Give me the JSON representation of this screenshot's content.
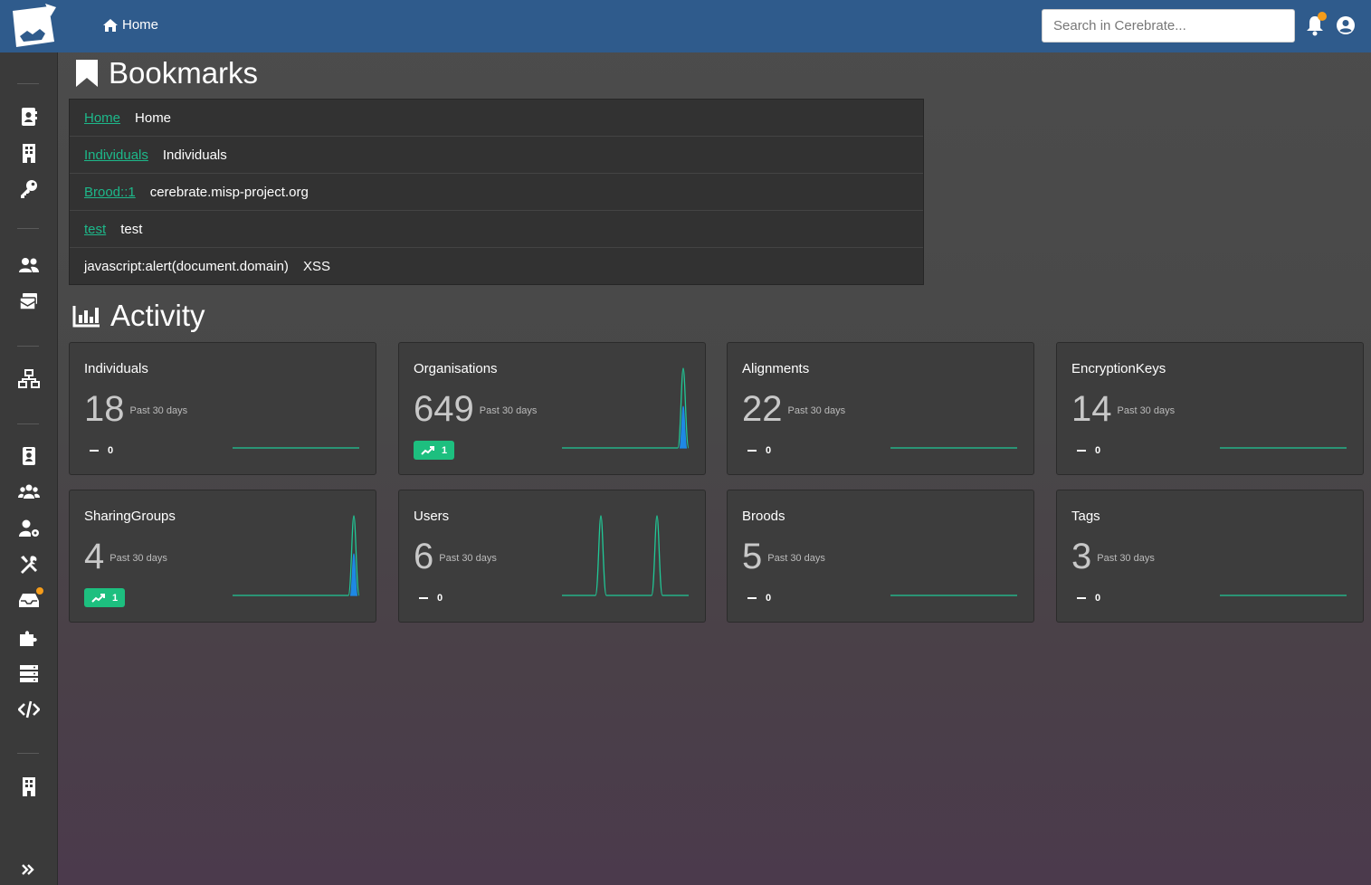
{
  "header": {
    "home_label": "Home",
    "search_placeholder": "Search in Cerebrate...",
    "has_notification": true
  },
  "bookmarks": {
    "title": "Bookmarks",
    "rows": [
      {
        "link": "Home",
        "name": "Home",
        "linked": true
      },
      {
        "link": "Individuals",
        "name": "Individuals",
        "linked": true
      },
      {
        "link": "Brood::1",
        "name": "cerebrate.misp-project.org",
        "linked": true
      },
      {
        "link": "test",
        "name": "test",
        "linked": true
      },
      {
        "link": "javascript:alert(document.domain)",
        "name": "XSS",
        "linked": false
      }
    ]
  },
  "activity": {
    "title": "Activity",
    "range_label": "Past 30 days",
    "cards": [
      {
        "title": "Individuals",
        "count": "18",
        "trend": "0",
        "trend_up": false,
        "spark": "flat"
      },
      {
        "title": "Organisations",
        "count": "649",
        "trend": "1",
        "trend_up": true,
        "spark": "end-spike"
      },
      {
        "title": "Alignments",
        "count": "22",
        "trend": "0",
        "trend_up": false,
        "spark": "flat"
      },
      {
        "title": "EncryptionKeys",
        "count": "14",
        "trend": "0",
        "trend_up": false,
        "spark": "flat"
      },
      {
        "title": "SharingGroups",
        "count": "4",
        "trend": "1",
        "trend_up": true,
        "spark": "end-spike"
      },
      {
        "title": "Users",
        "count": "6",
        "trend": "0",
        "trend_up": false,
        "spark": "double-spike"
      },
      {
        "title": "Broods",
        "count": "5",
        "trend": "0",
        "trend_up": false,
        "spark": "flat"
      },
      {
        "title": "Tags",
        "count": "3",
        "trend": "0",
        "trend_up": false,
        "spark": "flat"
      }
    ]
  },
  "sidebar": {
    "items": [
      "contacts-icon",
      "building-icon",
      "key-icon",
      "users-icon",
      "inbox-icon",
      "network-icon",
      "id-card-icon",
      "group-icon",
      "user-cog-icon",
      "tools-icon",
      "inbox-notification-icon",
      "puzzle-icon",
      "server-icon",
      "code-icon",
      "building-icon",
      "expand-icon"
    ]
  },
  "colors": {
    "header": "#2f5b8c",
    "accent": "#1db88a",
    "badge": "#f59c1a",
    "spark_green": "#20c997",
    "spark_blue": "#1e88e5"
  }
}
